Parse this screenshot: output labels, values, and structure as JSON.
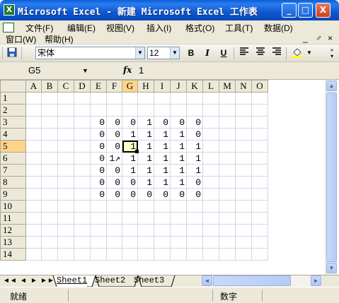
{
  "window": {
    "title": "Microsoft Excel - 新建 Microsoft Excel 工作表",
    "app_icon": "X",
    "minimize": "_",
    "maximize": "□",
    "close": "X"
  },
  "menu": {
    "items": [
      "文件(F)",
      "编辑(E)",
      "视图(V)",
      "插入(I)",
      "格式(O)",
      "工具(T)",
      "数据(D)"
    ],
    "row2": [
      "窗口(W)",
      "帮助(H)"
    ],
    "doc_controls": [
      "_",
      "♂",
      "×"
    ]
  },
  "toolbar": {
    "font_name": "宋体",
    "font_size": "12",
    "bold": "B",
    "italic": "I",
    "underline": "U"
  },
  "formula_bar": {
    "name_box": "G5",
    "fx": "fx",
    "value": "1"
  },
  "grid": {
    "columns": [
      "A",
      "B",
      "C",
      "D",
      "E",
      "F",
      "G",
      "H",
      "I",
      "J",
      "K",
      "L",
      "M",
      "N",
      "O"
    ],
    "active_column": "G",
    "active_row": "5",
    "rows": [
      {
        "num": "1",
        "cells": [
          "",
          "",
          "",
          "",
          "",
          "",
          "",
          "",
          "",
          "",
          "",
          "",
          "",
          "",
          ""
        ]
      },
      {
        "num": "2",
        "cells": [
          "",
          "",
          "",
          "",
          "",
          "",
          "",
          "",
          "",
          "",
          "",
          "",
          "",
          "",
          ""
        ]
      },
      {
        "num": "3",
        "cells": [
          "",
          "",
          "",
          "",
          "0",
          "0",
          "0",
          "1",
          "0",
          "0",
          "0",
          "",
          "",
          "",
          ""
        ]
      },
      {
        "num": "4",
        "cells": [
          "",
          "",
          "",
          "",
          "0",
          "0",
          "1",
          "1",
          "1",
          "1",
          "0",
          "",
          "",
          "",
          ""
        ]
      },
      {
        "num": "5",
        "cells": [
          "",
          "",
          "",
          "",
          "0",
          "0",
          "1",
          "1",
          "1",
          "1",
          "1",
          "",
          "",
          "",
          ""
        ]
      },
      {
        "num": "6",
        "cells": [
          "",
          "",
          "",
          "",
          "0",
          "1↗",
          "1",
          "1",
          "1",
          "1",
          "1",
          "",
          "",
          "",
          ""
        ]
      },
      {
        "num": "7",
        "cells": [
          "",
          "",
          "",
          "",
          "0",
          "0",
          "1",
          "1",
          "1",
          "1",
          "1",
          "",
          "",
          "",
          ""
        ]
      },
      {
        "num": "8",
        "cells": [
          "",
          "",
          "",
          "",
          "0",
          "0",
          "0",
          "1",
          "1",
          "1",
          "0",
          "",
          "",
          "",
          ""
        ]
      },
      {
        "num": "9",
        "cells": [
          "",
          "",
          "",
          "",
          "0",
          "0",
          "0",
          "0",
          "0",
          "0",
          "0",
          "",
          "",
          "",
          ""
        ]
      },
      {
        "num": "10",
        "cells": [
          "",
          "",
          "",
          "",
          "",
          "",
          "",
          "",
          "",
          "",
          "",
          "",
          "",
          "",
          ""
        ]
      },
      {
        "num": "11",
        "cells": [
          "",
          "",
          "",
          "",
          "",
          "",
          "",
          "",
          "",
          "",
          "",
          "",
          "",
          "",
          ""
        ]
      },
      {
        "num": "12",
        "cells": [
          "",
          "",
          "",
          "",
          "",
          "",
          "",
          "",
          "",
          "",
          "",
          "",
          "",
          "",
          ""
        ]
      },
      {
        "num": "13",
        "cells": [
          "",
          "",
          "",
          "",
          "",
          "",
          "",
          "",
          "",
          "",
          "",
          "",
          "",
          "",
          ""
        ]
      },
      {
        "num": "14",
        "cells": [
          "",
          "",
          "",
          "",
          "",
          "",
          "",
          "",
          "",
          "",
          "",
          "",
          "",
          "",
          ""
        ]
      }
    ]
  },
  "sheets": {
    "nav": [
      "◄◄",
      "◄",
      "►",
      "►►"
    ],
    "tabs": [
      "Sheet1",
      "Sheet2",
      "Sheet3"
    ],
    "active": "Sheet1"
  },
  "status": {
    "ready": "就绪",
    "mode": "数字"
  },
  "colors": {
    "titlebar": "#0a5fd8",
    "active_header": "#ffd38b",
    "chrome": "#ece9d8"
  }
}
